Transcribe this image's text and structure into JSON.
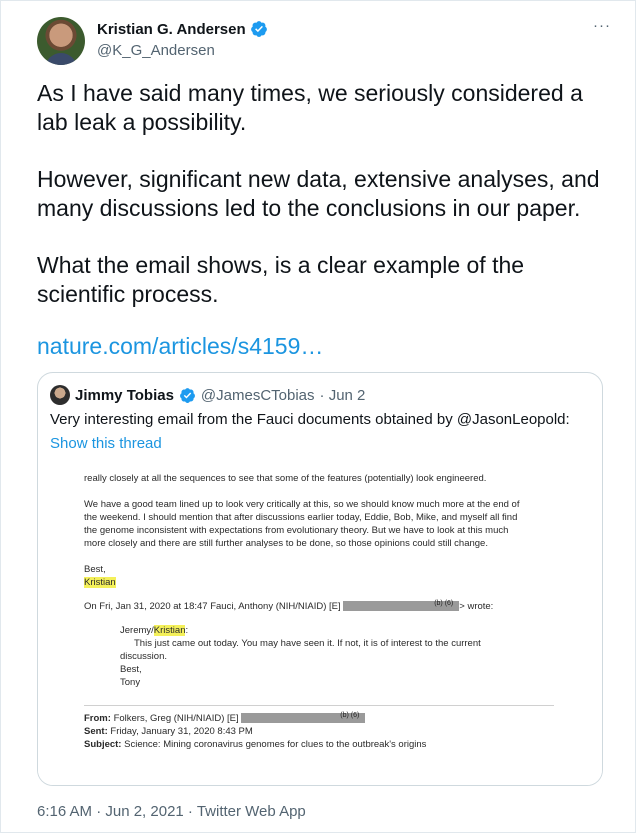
{
  "author": {
    "display_name": "Kristian G. Andersen",
    "handle": "@K_G_Andersen",
    "more_label": "···"
  },
  "tweet": {
    "para1": "As I have said many times, we seriously considered a lab leak a possibility.",
    "para2": "However, significant new data, extensive analyses, and many discussions led to the conclusions in our paper.",
    "para3": "What the email shows, is a clear example of the scientific process.",
    "link": "nature.com/articles/s4159…"
  },
  "quote": {
    "display_name": "Jimmy Tobias",
    "handle": "@JamesCTobias",
    "date": "· Jun 2",
    "text": "Very interesting email from the Fauci documents obtained by @JasonLeopold:",
    "thread_link": "Show this thread",
    "doc": {
      "l1": "really closely at all the sequences to see that some of the features (potentially) look engineered.",
      "l2": "We have a good team lined up to look very critically at this, so we should know much more at the end of",
      "l3": "the weekend. I should mention that after discussions earlier today, Eddie, Bob, Mike, and myself all find",
      "l4": "the genome inconsistent with expectations from evolutionary theory. But we have to look at this much",
      "l5": "more closely and there are still further analyses to be done, so those opinions could still change.",
      "best": "Best,",
      "kristian": "Kristian",
      "onfri": "On Fri, Jan 31, 2020 at 18:47 Fauci, Anthony (NIH/NIAID) [E]",
      "redact_code1": "(b) (6)",
      "wrote": "> wrote:",
      "jeremy": "Jeremy/",
      "kristian2": "Kristian",
      "colon": ":",
      "body1": "This just came out today.  You may have seen it.  If not, it is of interest to the current",
      "body2": "discussion.",
      "best2": "Best,",
      "tony": "Tony",
      "from_label": "From:",
      "from_value": "Folkers, Greg (NIH/NIAID) [E]",
      "redact_code2": "(b) (6)",
      "sent_label": "Sent:",
      "sent_value": "Friday, January 31, 2020 8:43 PM",
      "subject_label": "Subject:",
      "subject_value": "Science: Mining coronavirus genomes for clues to the outbreak's origins"
    }
  },
  "footer": {
    "timestamp": "6:16 AM · Jun 2, 2021 · Twitter Web App"
  },
  "colors": {
    "accent": "#1b95e0",
    "verified": "#1d9bf0",
    "highlight": "#f4f05a"
  }
}
